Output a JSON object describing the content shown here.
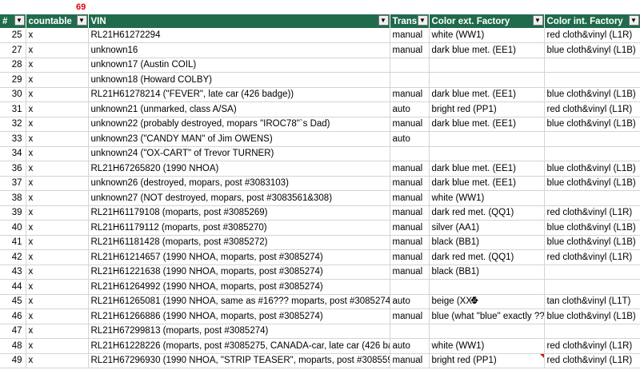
{
  "filter_count": "69",
  "headers": [
    "#",
    "countable",
    "VIN",
    "Trans",
    "Color ext. Factory",
    "Color int. Factory"
  ],
  "rows": [
    [
      "25",
      "x",
      "RL21H61272294",
      "manual",
      "white (WW1)",
      "red cloth&vinyl (L1R)"
    ],
    [
      "27",
      "x",
      "unknown16",
      "manual",
      "dark blue met. (EE1)",
      "blue cloth&vinyl (L1B)"
    ],
    [
      "28",
      "x",
      "unknown17 (Austin COIL)",
      "",
      "",
      ""
    ],
    [
      "29",
      "x",
      "unknown18 (Howard COLBY)",
      "",
      "",
      ""
    ],
    [
      "30",
      "x",
      "RL21H61278214 (\"FEVER\", late car (426 badge))",
      "manual",
      "dark blue met. (EE1)",
      "blue cloth&vinyl (L1B)"
    ],
    [
      "31",
      "x",
      "unknown21 (unmarked, class A/SA)",
      "auto",
      "bright red (PP1)",
      "red cloth&vinyl (L1R)"
    ],
    [
      "32",
      "x",
      "unknown22 (probably destroyed, mopars \"IROC78\"`s Dad)",
      "manual",
      "dark blue met. (EE1)",
      "blue cloth&vinyl (L1B)"
    ],
    [
      "33",
      "x",
      "unknown23 (\"CANDY MAN\" of Jim OWENS)",
      "auto",
      "",
      ""
    ],
    [
      "34",
      "x",
      "unknown24 (\"OX-CART\" of Trevor TURNER)",
      "",
      "",
      ""
    ],
    [
      "36",
      "x",
      "RL21H67265820 (1990 NHOA)",
      "manual",
      "dark blue met. (EE1)",
      "blue cloth&vinyl (L1B)"
    ],
    [
      "37",
      "x",
      "unknown26 (destroyed, mopars, post #3083103)",
      "manual",
      "dark blue met. (EE1)",
      "blue cloth&vinyl (L1B)"
    ],
    [
      "38",
      "x",
      "unknown27 (NOT destroyed, mopars, post #3083561&308)",
      "manual",
      "white (WW1)",
      ""
    ],
    [
      "39",
      "x",
      "RL21H61179108 (moparts, post #3085269)",
      "manual",
      "dark red met. (QQ1)",
      "red cloth&vinyl (L1R)"
    ],
    [
      "40",
      "x",
      "RL21H61179112 (moparts, post #3085270)",
      "manual",
      "silver (AA1)",
      "blue cloth&vinyl (L1B)"
    ],
    [
      "41",
      "x",
      "RL21H61181428 (moparts, post #3085272)",
      "manual",
      "black (BB1)",
      "blue cloth&vinyl (L1B)"
    ],
    [
      "42",
      "x",
      "RL21H61214657 (1990 NHOA, moparts, post #3085274)",
      "manual",
      "dark red met. (QQ1)",
      "red cloth&vinyl (L1R)"
    ],
    [
      "43",
      "x",
      "RL21H61221638 (1990 NHOA, moparts, post #3085274)",
      "manual",
      "black (BB1)",
      ""
    ],
    [
      "44",
      "x",
      "RL21H61264992 (1990 NHOA, moparts, post #3085274)",
      "",
      "",
      ""
    ],
    [
      "45",
      "x",
      "RL21H61265081 (1990 NHOA, same as #16??? moparts, post #3085274)",
      "auto",
      "beige (XX5",
      "tan cloth&vinyl (L1T)"
    ],
    [
      "46",
      "x",
      "RL21H61266886 (1990 NHOA, moparts, post #3085274)",
      "manual",
      "blue (what \"blue\" exactly ??",
      "blue cloth&vinyl (L1B)"
    ],
    [
      "47",
      "x",
      "RL21H67299813 (moparts, post #3085274)",
      "",
      "",
      ""
    ],
    [
      "48",
      "x",
      "RL21H61228226 (moparts, post #3085275, CANADA-car, late car (426 ba",
      "auto",
      "white (WW1)",
      "red cloth&vinyl (L1R)"
    ],
    [
      "49",
      "x",
      "RL21H67296930 (1990 NHOA, \"STRIP TEASER\", moparts, post #3085597,",
      "manual",
      "bright red (PP1)",
      "red cloth&vinyl (L1R)"
    ]
  ]
}
